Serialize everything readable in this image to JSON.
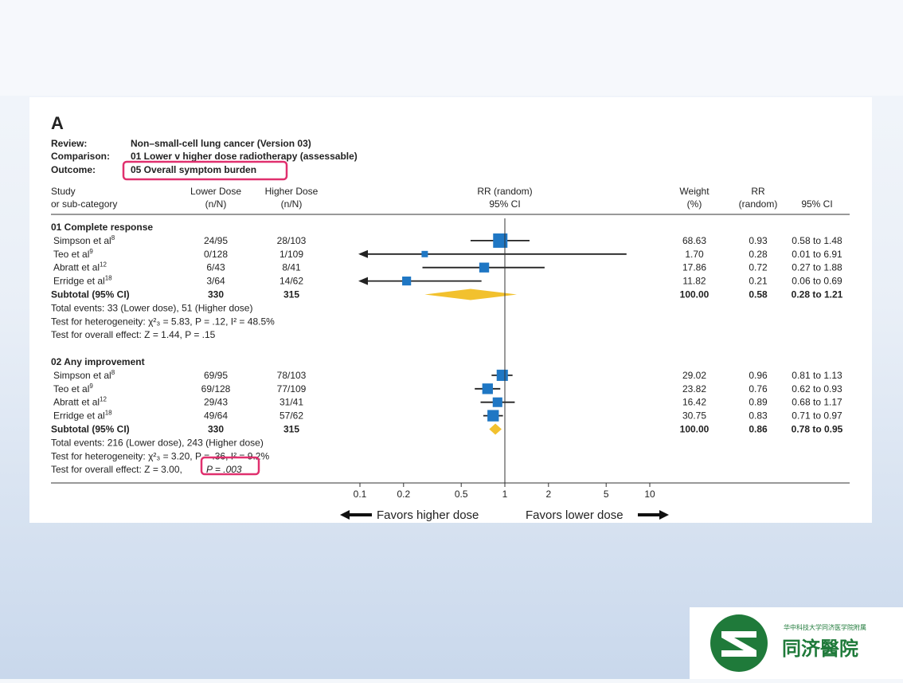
{
  "panel_letter": "A",
  "meta": {
    "review_label": "Review:",
    "review_value": "Non–small-cell lung cancer (Version 03)",
    "comparison_label": "Comparison:",
    "comparison_value": "01 Lower v higher dose radiotherapy (assessable)",
    "outcome_label": "Outcome:",
    "outcome_value": "05 Overall symptom burden"
  },
  "headers": {
    "study_1": "Study",
    "study_2": "or sub-category",
    "lower_1": "Lower Dose",
    "lower_2": "(n/N)",
    "higher_1": "Higher Dose",
    "higher_2": "(n/N)",
    "rr_1": "RR (random)",
    "rr_2": "95% CI",
    "weight_1": "Weight",
    "weight_2": "(%)",
    "rrv_1": "RR",
    "rrv_2": "(random)",
    "ci": "95% CI"
  },
  "groups": [
    {
      "title": "01 Complete response",
      "studies": [
        {
          "name": "Simpson et al",
          "ref": "8",
          "lower": "24/95",
          "higher": "28/103",
          "weight": "68.63",
          "rr": "0.93",
          "ci": "0.58 to 1.48",
          "est": 0.93,
          "lo": 0.58,
          "hi": 1.48,
          "arrow_left": false
        },
        {
          "name": "Teo et al",
          "ref": "9",
          "lower": "0/128",
          "higher": "1/109",
          "weight": "1.70",
          "rr": "0.28",
          "ci": "0.01 to 6.91",
          "est": 0.28,
          "lo": 0.01,
          "hi": 6.91,
          "arrow_left": true
        },
        {
          "name": "Abratt et al",
          "ref": "12",
          "lower": "6/43",
          "higher": "8/41",
          "weight": "17.86",
          "rr": "0.72",
          "ci": "0.27 to 1.88",
          "est": 0.72,
          "lo": 0.27,
          "hi": 1.88,
          "arrow_left": false
        },
        {
          "name": "Erridge et al",
          "ref": "18",
          "lower": "3/64",
          "higher": "14/62",
          "weight": "11.82",
          "rr": "0.21",
          "ci": "0.06 to 0.69",
          "est": 0.21,
          "lo": 0.06,
          "hi": 0.69,
          "arrow_left": true
        }
      ],
      "subtotal": {
        "label": "Subtotal (95% CI)",
        "lower": "330",
        "higher": "315",
        "weight": "100.00",
        "rr": "0.58",
        "ci": "0.28 to 1.21",
        "est": 0.58,
        "lo": 0.28,
        "hi": 1.21
      },
      "total_events": "Total events: 33 (Lower dose), 51 (Higher dose)",
      "heterogeneity": "Test for heterogeneity: χ²₃ = 5.83, P = .12, I² = 48.5%",
      "overall_effect": "Test for overall effect: Z = 1.44, P = .15"
    },
    {
      "title": "02 Any improvement",
      "studies": [
        {
          "name": "Simpson et al",
          "ref": "8",
          "lower": "69/95",
          "higher": "78/103",
          "weight": "29.02",
          "rr": "0.96",
          "ci": "0.81 to 1.13",
          "est": 0.96,
          "lo": 0.81,
          "hi": 1.13,
          "arrow_left": false
        },
        {
          "name": "Teo et al",
          "ref": "9",
          "lower": "69/128",
          "higher": "77/109",
          "weight": "23.82",
          "rr": "0.76",
          "ci": "0.62 to 0.93",
          "est": 0.76,
          "lo": 0.62,
          "hi": 0.93,
          "arrow_left": false
        },
        {
          "name": "Abratt et al",
          "ref": "12",
          "lower": "29/43",
          "higher": "31/41",
          "weight": "16.42",
          "rr": "0.89",
          "ci": "0.68 to 1.17",
          "est": 0.89,
          "lo": 0.68,
          "hi": 1.17,
          "arrow_left": false
        },
        {
          "name": "Erridge et al",
          "ref": "18",
          "lower": "49/64",
          "higher": "57/62",
          "weight": "30.75",
          "rr": "0.83",
          "ci": "0.71 to 0.97",
          "est": 0.83,
          "lo": 0.71,
          "hi": 0.97,
          "arrow_left": false
        }
      ],
      "subtotal": {
        "label": "Subtotal (95% CI)",
        "lower": "330",
        "higher": "315",
        "weight": "100.00",
        "rr": "0.86",
        "ci": "0.78 to 0.95",
        "est": 0.86,
        "lo": 0.78,
        "hi": 0.95
      },
      "total_events": "Total events: 216 (Lower dose), 243 (Higher dose)",
      "heterogeneity": "Test for heterogeneity: χ²₃ = 3.20, P = .36, I² = 9.2%",
      "overall_effect_prefix": "Test for overall effect: Z = 3.00,",
      "overall_effect_p": "P = .003"
    }
  ],
  "axis": {
    "ticks": [
      "0.1",
      "0.2",
      "0.5",
      "1",
      "2",
      "5",
      "10"
    ],
    "favors_left": "Favors higher dose",
    "favors_right": "Favors lower dose"
  },
  "chart_data": {
    "type": "forest",
    "scale": "log",
    "xlim": [
      0.1,
      10
    ],
    "reference_line": 1,
    "square_color": "#1f77c4",
    "diamond_color": "#f2c12e",
    "highlight_color": "#e0306e"
  },
  "logo": {
    "subtitle": "华中科技大学同济医学院附属",
    "title": "同济醫院"
  }
}
